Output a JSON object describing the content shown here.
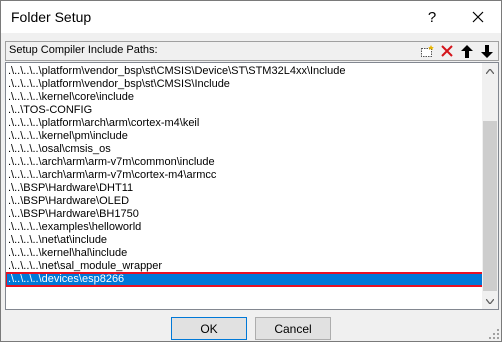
{
  "window": {
    "title": "Folder Setup",
    "help_label": "?",
    "close_icon": "close-icon"
  },
  "header": {
    "label": "Setup Compiler Include Paths:",
    "toolbar": [
      "new-folder-icon",
      "delete-icon",
      "move-up-icon",
      "move-down-icon"
    ]
  },
  "paths": [
    ".\\..\\..\\..\\platform\\vendor_bsp\\st\\CMSIS\\Device\\ST\\STM32L4xx\\Include",
    ".\\..\\..\\..\\platform\\vendor_bsp\\st\\CMSIS\\Include",
    ".\\..\\..\\..\\kernel\\core\\include",
    ".\\..\\TOS-CONFIG",
    ".\\..\\..\\..\\platform\\arch\\arm\\cortex-m4\\keil",
    ".\\..\\..\\..\\kernel\\pm\\include",
    ".\\..\\..\\..\\osal\\cmsis_os",
    ".\\..\\..\\..\\arch\\arm\\arm-v7m\\common\\include",
    ".\\..\\..\\..\\arch\\arm\\arm-v7m\\cortex-m4\\armcc",
    ".\\..\\BSP\\Hardware\\DHT11",
    ".\\..\\BSP\\Hardware\\OLED",
    ".\\..\\BSP\\Hardware\\BH1750",
    ".\\..\\..\\..\\examples\\helloworld",
    ".\\..\\..\\..\\net\\at\\include",
    ".\\..\\..\\..\\kernel\\hal\\include",
    ".\\..\\..\\..\\net\\sal_module_wrapper",
    ".\\..\\..\\..\\devices\\esp8266"
  ],
  "selected_index": 16,
  "buttons": {
    "ok": "OK",
    "cancel": "Cancel"
  },
  "colors": {
    "selection": "#0078d7",
    "highlight_border": "#e81123"
  }
}
